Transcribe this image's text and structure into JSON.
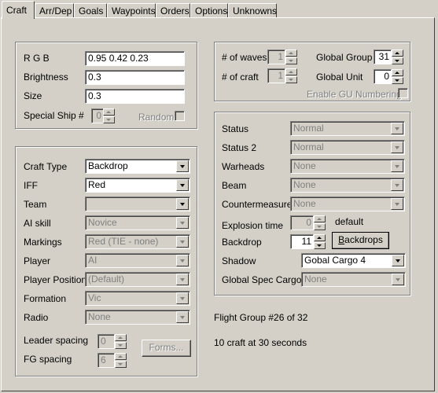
{
  "tabs": [
    {
      "label": "Craft"
    },
    {
      "label": "Arr/Dep"
    },
    {
      "label": "Goals"
    },
    {
      "label": "Waypoints"
    },
    {
      "label": "Orders"
    },
    {
      "label": "Options"
    },
    {
      "label": "Unknowns"
    }
  ],
  "appearance": {
    "rgb_label": "R G B",
    "rgb_value": "0.95 0.42 0.23",
    "brightness_label": "Brightness",
    "brightness_value": "0.3",
    "size_label": "Size",
    "size_value": "0.3",
    "special_ship_label": "Special Ship #",
    "special_ship_value": "0",
    "random_label": "Random"
  },
  "craft": {
    "craft_type_label": "Craft Type",
    "craft_type_value": "Backdrop",
    "iff_label": "IFF",
    "iff_value": "Red",
    "team_label": "Team",
    "team_value": "",
    "ai_skill_label": "AI skill",
    "ai_skill_value": "Novice",
    "markings_label": "Markings",
    "markings_value": "Red (TIE - none)",
    "player_label": "Player",
    "player_value": "AI",
    "player_position_label": "Player Position",
    "player_position_value": "(Default)",
    "formation_label": "Formation",
    "formation_value": "Vic",
    "radio_label": "Radio",
    "radio_value": "None",
    "leader_spacing_label": "Leader spacing",
    "leader_spacing_value": "0",
    "fg_spacing_label": "FG spacing",
    "fg_spacing_value": "6",
    "forms_button": "Forms..."
  },
  "waves": {
    "num_waves_label": "# of waves",
    "num_waves_value": "1",
    "num_craft_label": "# of craft",
    "num_craft_value": "1",
    "global_group_label": "Global Group",
    "global_group_value": "31",
    "global_unit_label": "Global Unit",
    "global_unit_value": "0",
    "enable_gu_label": "Enable GU Numbering"
  },
  "status": {
    "status_label": "Status",
    "status_value": "Normal",
    "status2_label": "Status 2",
    "status2_value": "Normal",
    "warheads_label": "Warheads",
    "warheads_value": "None",
    "beam_label": "Beam",
    "beam_value": "None",
    "countermeasures_label": "Countermeasures",
    "countermeasures_value": "None",
    "explosion_label": "Explosion time",
    "explosion_value": "0",
    "explosion_default": "default",
    "backdrop_label": "Backdrop",
    "backdrop_value": "11",
    "backdrops_button_prefix": "B",
    "backdrops_button_rest": "ackdrops",
    "shadow_label": "Shadow",
    "shadow_value": "Gobal Cargo 4",
    "global_spec_cargo_label": "Global Spec Cargo",
    "global_spec_cargo_value": "None"
  },
  "info": {
    "flight_group": "Flight Group #26 of 32",
    "craft_summary": "10 craft at 30 seconds"
  }
}
